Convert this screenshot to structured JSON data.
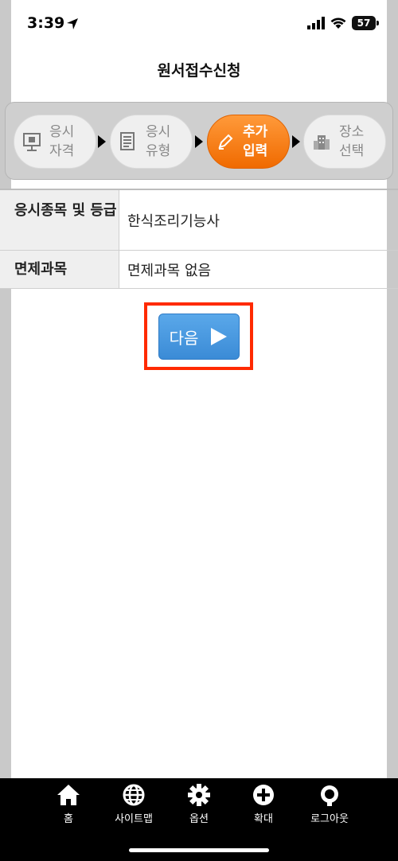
{
  "status": {
    "time": "3:39",
    "battery": "57"
  },
  "header": {
    "title": "원서접수신청"
  },
  "steps": [
    {
      "line1": "응시",
      "line2": "자격",
      "icon": "presentation-icon",
      "active": false
    },
    {
      "line1": "응시",
      "line2": "유형",
      "icon": "document-icon",
      "active": false
    },
    {
      "line1": "추가",
      "line2": "입력",
      "icon": "pencil-icon",
      "active": true
    },
    {
      "line1": "장소",
      "line2": "선택",
      "icon": "building-icon",
      "active": false
    }
  ],
  "table": {
    "rows": [
      {
        "label": "응시종목 및 등급",
        "value": "한식조리기능사"
      },
      {
        "label": "면제과목",
        "value": "면제과목 없음"
      }
    ]
  },
  "next_button": {
    "label": "다음"
  },
  "colors": {
    "accent": "#f07a10",
    "button": "#4a9be0",
    "highlight": "#ff2a00"
  },
  "bottom_nav": [
    {
      "label": "홈",
      "icon": "home-icon"
    },
    {
      "label": "사이트맵",
      "icon": "globe-icon"
    },
    {
      "label": "옵션",
      "icon": "gear-icon"
    },
    {
      "label": "확대",
      "icon": "plus-circle-icon"
    },
    {
      "label": "로그아웃",
      "icon": "logout-icon"
    }
  ]
}
